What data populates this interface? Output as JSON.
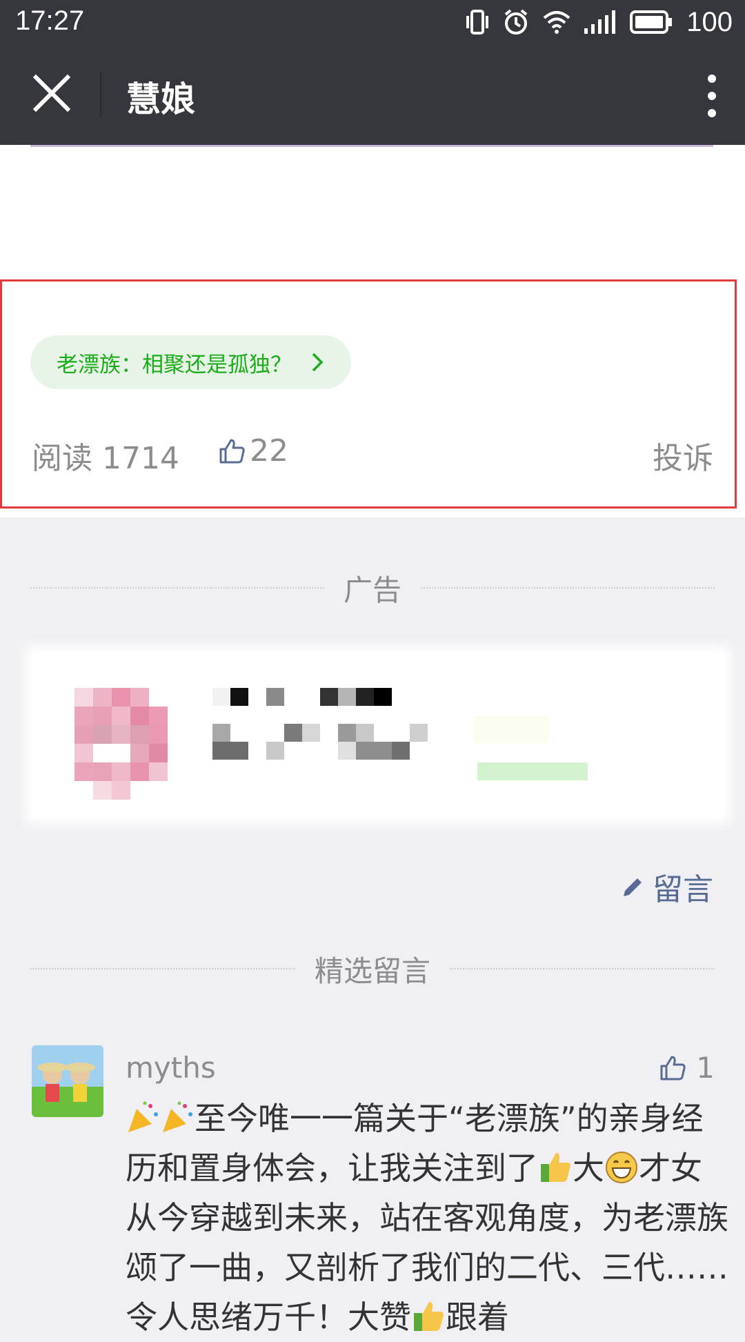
{
  "status_bar": {
    "time": "17:27",
    "battery": "100",
    "icons": [
      "vibrate-icon",
      "alarm-icon",
      "wifi-icon",
      "signal-icon",
      "battery-icon"
    ]
  },
  "title_bar": {
    "title": "慧娘",
    "close_icon": "close-icon",
    "more_icon": "more-vertical-icon"
  },
  "article": {
    "tag_link": "老漂族：相聚还是孤独？",
    "read_label": "阅读 1714",
    "like_count": "22",
    "report_label": "投诉"
  },
  "ad": {
    "section_label": "广告"
  },
  "comments": {
    "write_label": "留言",
    "section_label": "精选留言",
    "items": [
      {
        "nickname": "myths",
        "likes": "1",
        "text_1": "至今唯一一篇关于“老漂族”的亲身经历和置身体会，让我关注到了",
        "text_2": "大",
        "text_3": "才女从今穿越到未来，站在客观角度，为老漂族颂了一曲，又剖析了我们的二代、三代……令人思绪万千！大赞",
        "text_4": "跟着"
      }
    ]
  },
  "colors": {
    "header_bg": "#36373c",
    "link_green": "#1aad19",
    "link_blue": "#576b95",
    "highlight_red": "#e03a3a"
  }
}
